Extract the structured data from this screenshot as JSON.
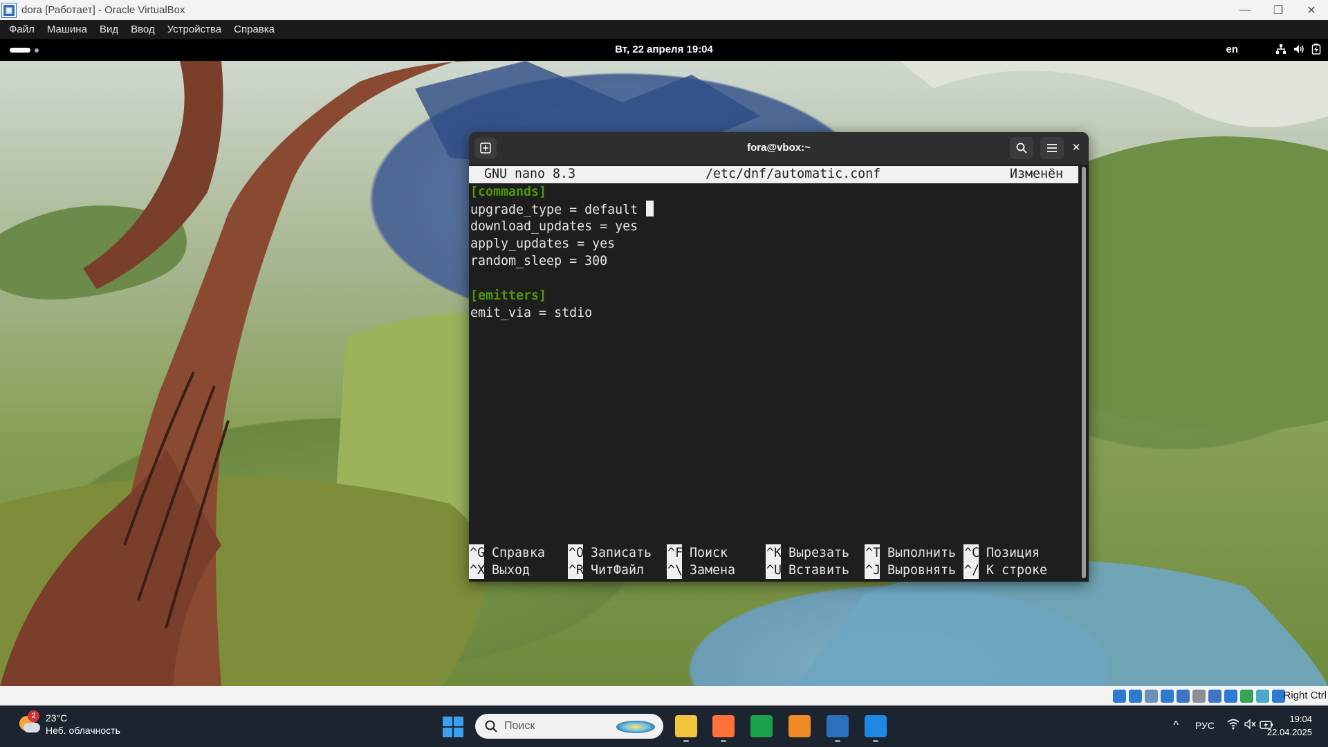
{
  "host_window": {
    "title": "dora [Работает] - Oracle VirtualBox",
    "icon": "virtualbox-icon",
    "controls": [
      "minimize-icon",
      "maximize-icon",
      "close-icon"
    ]
  },
  "vbox_menu": {
    "items": [
      "Файл",
      "Машина",
      "Вид",
      "Ввод",
      "Устройства",
      "Справка"
    ]
  },
  "gnome_topbar": {
    "datetime": "Вт, 22 апреля  19:04",
    "keyboard_layout": "en",
    "indicators": [
      "network-icon",
      "volume-icon",
      "battery-icon"
    ]
  },
  "terminal": {
    "title": "fora@vbox:~"
  },
  "nano": {
    "version": "GNU nano 8.3",
    "filename": "/etc/dnf/automatic.conf",
    "status": "Изменён",
    "lines": [
      {
        "text": "[commands]",
        "type": "section"
      },
      {
        "text": "upgrade_type = default ",
        "type": "text",
        "cursor": true
      },
      {
        "text": "download_updates = yes",
        "type": "text"
      },
      {
        "text": "apply_updates = yes",
        "type": "text"
      },
      {
        "text": "random_sleep = 300",
        "type": "text"
      },
      {
        "text": "",
        "type": "text"
      },
      {
        "text": "[emitters]",
        "type": "section"
      },
      {
        "text": "emit_via = stdio",
        "type": "text"
      }
    ],
    "shortcuts": [
      [
        {
          "key": "^G",
          "label": "Справка"
        },
        {
          "key": "^O",
          "label": "Записать"
        },
        {
          "key": "^F",
          "label": "Поиск"
        },
        {
          "key": "^K",
          "label": "Вырезать"
        },
        {
          "key": "^T",
          "label": "Выполнить"
        },
        {
          "key": "^C",
          "label": "Позиция"
        }
      ],
      [
        {
          "key": "^X",
          "label": "Выход"
        },
        {
          "key": "^R",
          "label": "ЧитФайл"
        },
        {
          "key": "^\\",
          "label": "Замена"
        },
        {
          "key": "^U",
          "label": "Вставить"
        },
        {
          "key": "^J",
          "label": "Выровнять"
        },
        {
          "key": "^/",
          "label": "К строке"
        }
      ]
    ]
  },
  "vbox_status": {
    "host_key": "Right Ctrl",
    "icons": [
      "hard-disk-icon",
      "optical-disk-icon",
      "audio-icon",
      "network-adapter-icon",
      "usb-icon",
      "shared-folders-icon",
      "display-icon",
      "recording-icon",
      "cpu-icon",
      "mouse-integration-icon",
      "keyboard-icon"
    ],
    "icon_colors": [
      "#2d7bd1",
      "#2d7bd1",
      "#6b8fb8",
      "#2d7bd1",
      "#3d74c4",
      "#8a8f96",
      "#3d74c4",
      "#2d7bd1",
      "#3aa35a",
      "#4aa8c8",
      "#2d7bd1"
    ]
  },
  "taskbar": {
    "weather": {
      "temp": "23°C",
      "desc": "Неб. облачность",
      "badge": "2"
    },
    "search_placeholder": "Поиск",
    "apps": [
      {
        "name": "file-explorer-icon",
        "color": "#f2c33d"
      },
      {
        "name": "firefox-icon",
        "color": "#ff7139"
      },
      {
        "name": "qc-icon",
        "color": "#1aa34a"
      },
      {
        "name": "sublime-text-icon",
        "color": "#f08a24"
      },
      {
        "name": "visual-studio-icon",
        "color": "#2b6fbf"
      },
      {
        "name": "virtualbox-icon",
        "color": "#1e88e5"
      }
    ],
    "tray": {
      "lang": "РУС",
      "time": "19:04",
      "date": "22.04.2025"
    }
  }
}
